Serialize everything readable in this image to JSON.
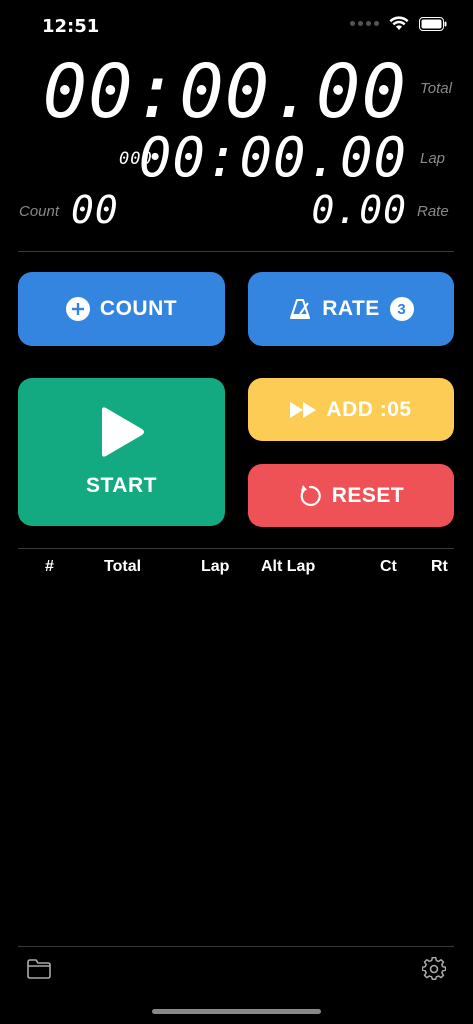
{
  "status": {
    "time": "12:51"
  },
  "display": {
    "total": "00:00.00",
    "total_label": "Total",
    "lap": "00:00.00",
    "lap_label": "Lap",
    "lap_number": "000",
    "count_label": "Count",
    "count": "00",
    "rate": "0.00",
    "rate_label": "Rate"
  },
  "buttons": {
    "count_label": "COUNT",
    "rate_label": "RATE",
    "rate_badge": "3",
    "start_label": "START",
    "add_label": "ADD :05",
    "reset_label": "RESET"
  },
  "table": {
    "columns": [
      "#",
      "Total",
      "Lap",
      "Alt Lap",
      "Ct",
      "Rt"
    ]
  },
  "icons": {
    "status": [
      "signal-icon",
      "wifi-icon",
      "battery-icon"
    ],
    "count_button": "plus-circle-icon",
    "rate_button": "metronome-icon",
    "start_button": "play-icon",
    "add_button": "fast-forward-icon",
    "reset_button": "reset-icon",
    "toolbar_left": "folder-icon",
    "toolbar_right": "gear-icon"
  },
  "colors": {
    "blue": "#3485e0",
    "green": "#13aa82",
    "yellow": "#fccc55",
    "red": "#ee5256"
  }
}
